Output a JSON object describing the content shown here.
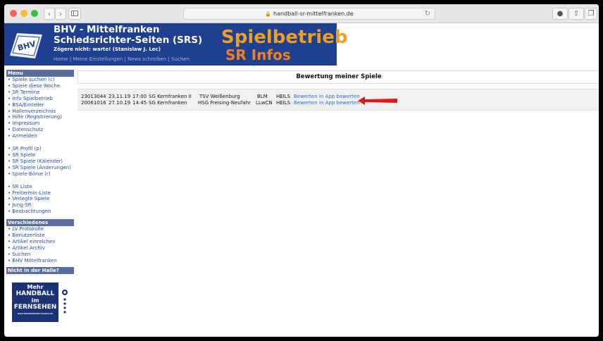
{
  "browser": {
    "url": "handball-sr-mittelfranken.de",
    "back_icon": "chevron-left-icon",
    "forward_icon": "chevron-right-icon"
  },
  "header": {
    "title_line1": "BHV - Mittelfranken",
    "title_line2": "Schiedsrichter-Seiten (SRS)",
    "slogan": "Zögere nicht: warte! (Stanislaw J. Lec)",
    "nav": [
      "Home",
      "Meine Einstellungen",
      "News schreiben",
      "Suchen"
    ],
    "nav_sep": "|",
    "banner_big": "Spielbetrieb",
    "banner_small": "SR Infos"
  },
  "sidebar": {
    "menu_heading": "Menu",
    "menu_group1": [
      "Spiele suchen (c)",
      "Spiele diese Woche",
      "SR Termine",
      "Info Spielbetrieb",
      "BSA/Einteiler",
      "Hallenverzeichnis",
      "Hilfe (Registrierung)",
      "Impressum",
      "Datenschutz",
      "Anmelden"
    ],
    "menu_group2": [
      "SR Profil (p)",
      "SR Spiele",
      "SR Spiele (Kalender)",
      "SR Spiele (Änderungen)",
      "Spiele-Börse (r)"
    ],
    "menu_group3": [
      "SR Liste",
      "Freitermin-Liste",
      "Verlegte Spiele",
      "Jung-SR",
      "Beobachtungen"
    ],
    "misc_heading": "Verschiedenes",
    "misc_items": [
      "LV Protokolle",
      "Benutzerliste",
      "Artikel einreichen",
      "Artikel Archiv",
      "Suchen",
      "BHV Mittelfranken"
    ],
    "promo_heading": "Nicht in der Halle?",
    "promo_line1": "Mehr",
    "promo_line2": "HANDBALL",
    "promo_line3": "im",
    "promo_line4": "FERNSEHEN",
    "promo_url": "www.handballimfernsehen.de"
  },
  "main": {
    "title": "Bewertung meiner Spiele",
    "games": [
      {
        "nr": "23013044",
        "date": "23.11.19",
        "time": "17:00",
        "home": "SG Kernfranken II",
        "away": "TSV Weißenburg",
        "league": "BLM",
        "ref": "HEILS",
        "action1": "Bewerten",
        "action2": "in App bewerten"
      },
      {
        "nr": "20061016",
        "date": "27.10.19",
        "time": "14:45",
        "home": "SG Kernfranken",
        "away": "HSG Freising-Neufahr",
        "league": "LLwCN",
        "ref": "HEILS",
        "action1": "Bewerten",
        "action2": "in App bewerten"
      }
    ]
  },
  "colors": {
    "banner_bg": "#1f3f8f",
    "sidebar_heading_bg": "#5a6d9c",
    "link": "#2a6ad0",
    "annotation_arrow": "#e01818"
  }
}
